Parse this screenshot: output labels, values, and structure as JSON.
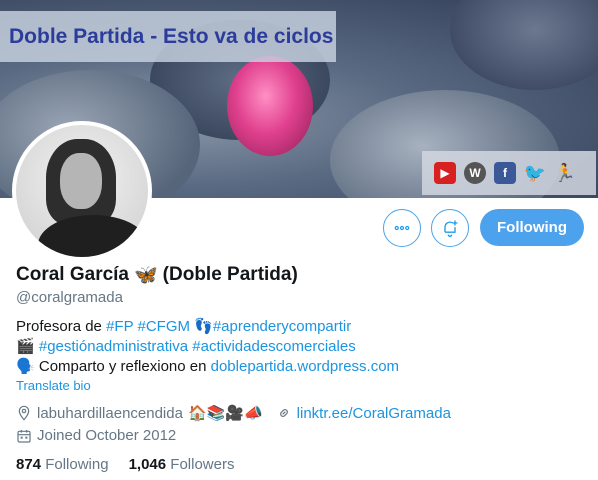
{
  "banner": {
    "title": "Doble Partida - Esto va de ciclos",
    "social_icons": [
      "youtube-icon",
      "wordpress-icon",
      "facebook-icon",
      "twitter-icon",
      "figure-icon"
    ]
  },
  "actions": {
    "more_icon": "more-icon",
    "notify_icon": "bell-plus-icon",
    "following_label": "Following"
  },
  "profile": {
    "name": "Coral García",
    "name_emoji": "🦋",
    "name_suffix": "(Doble Partida)",
    "handle": "@coralgramada"
  },
  "bio": {
    "line1_prefix": "Profesora de ",
    "tag_fp": "#FP",
    "tag_cfgm": "#CFGM",
    "emoji_feet": "👣",
    "tag_aprender": "#aprenderycompartir",
    "emoji_clapper": "🎬",
    "tag_gestion": "#gestiónadministrativa",
    "tag_actividades": "#actividadescomerciales",
    "emoji_speaker": "🗣️",
    "line3_prefix": "Comparto y reflexiono en ",
    "blog_link": "doblepartida.wordpress.com",
    "translate_label": "Translate bio"
  },
  "meta": {
    "location": "labuhardillaencendida",
    "location_emojis": "🏠📚🎥📣",
    "website": "linktr.ee/CoralGramada",
    "joined": "Joined October 2012"
  },
  "stats": {
    "following_count": "874",
    "following_label": "Following",
    "followers_count": "1,046",
    "followers_label": "Followers"
  },
  "colors": {
    "accent": "#1b95e0",
    "button_bg": "#4da2ee",
    "muted": "#657786"
  }
}
